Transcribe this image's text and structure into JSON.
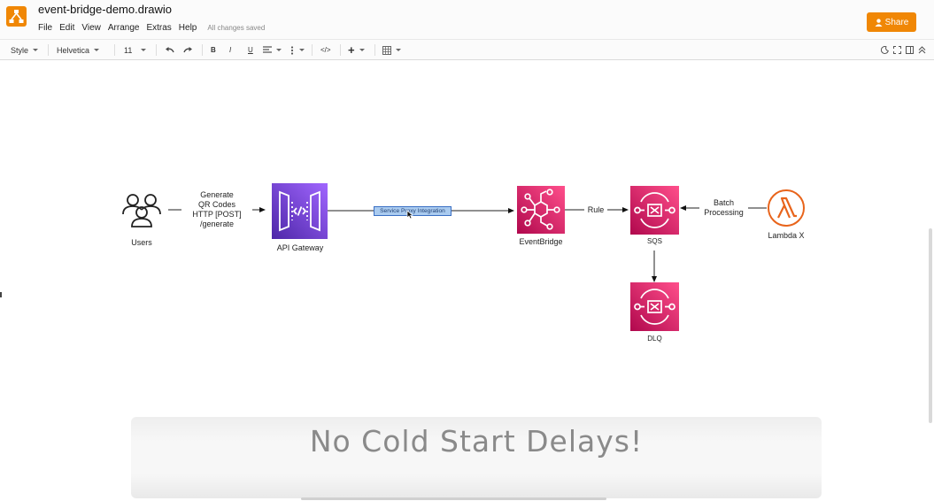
{
  "app": {
    "file_title": "event-bridge-demo.drawio",
    "logo_icon": "drawio-logo-icon",
    "brand_color": "#f08705"
  },
  "menu": {
    "items": [
      "File",
      "Edit",
      "View",
      "Arrange",
      "Extras",
      "Help"
    ],
    "save_status": "All changes saved"
  },
  "share": {
    "label": "Share",
    "icon": "user-icon"
  },
  "toolbar": {
    "style_label": "Style",
    "font_label": "Helvetica",
    "size_label": "11",
    "icons": [
      "undo-icon",
      "redo-icon",
      "bold-icon",
      "italic-icon",
      "underline-icon",
      "align-icon",
      "vertical-align-icon",
      "code-icon",
      "insert-plus-icon",
      "table-icon",
      "dark-mode-icon",
      "fullscreen-icon",
      "format-panel-icon",
      "collapse-icon"
    ]
  },
  "diagram": {
    "nodes": {
      "users": {
        "label": "Users",
        "icon": "users-icon"
      },
      "api_gateway": {
        "label": "API Gateway",
        "icon": "api-gateway-icon",
        "color": "#7b3ff2"
      },
      "eventbridge": {
        "label": "EventBridge",
        "icon": "eventbridge-icon",
        "color": "#e7157b"
      },
      "sqs": {
        "label": "SQS",
        "icon": "sqs-icon",
        "color": "#e7157b"
      },
      "dlq": {
        "label": "DLQ",
        "icon": "dlq-icon",
        "color": "#e7157b"
      },
      "lambda": {
        "label": "Lambda X",
        "icon": "lambda-icon",
        "color": "#e8641b"
      }
    },
    "edges": {
      "users_to_api": {
        "lines": [
          "Generate",
          "QR Codes",
          "HTTP [POST]",
          "/generate"
        ]
      },
      "api_to_eventbridge": {
        "label": "Service Proxy Integration"
      },
      "eventbridge_to_sqs": {
        "label": "Rule"
      },
      "lambda_to_sqs": {
        "lines": [
          "Batch",
          "Processing"
        ]
      }
    }
  },
  "banner": {
    "text": "No Cold Start Delays!"
  }
}
